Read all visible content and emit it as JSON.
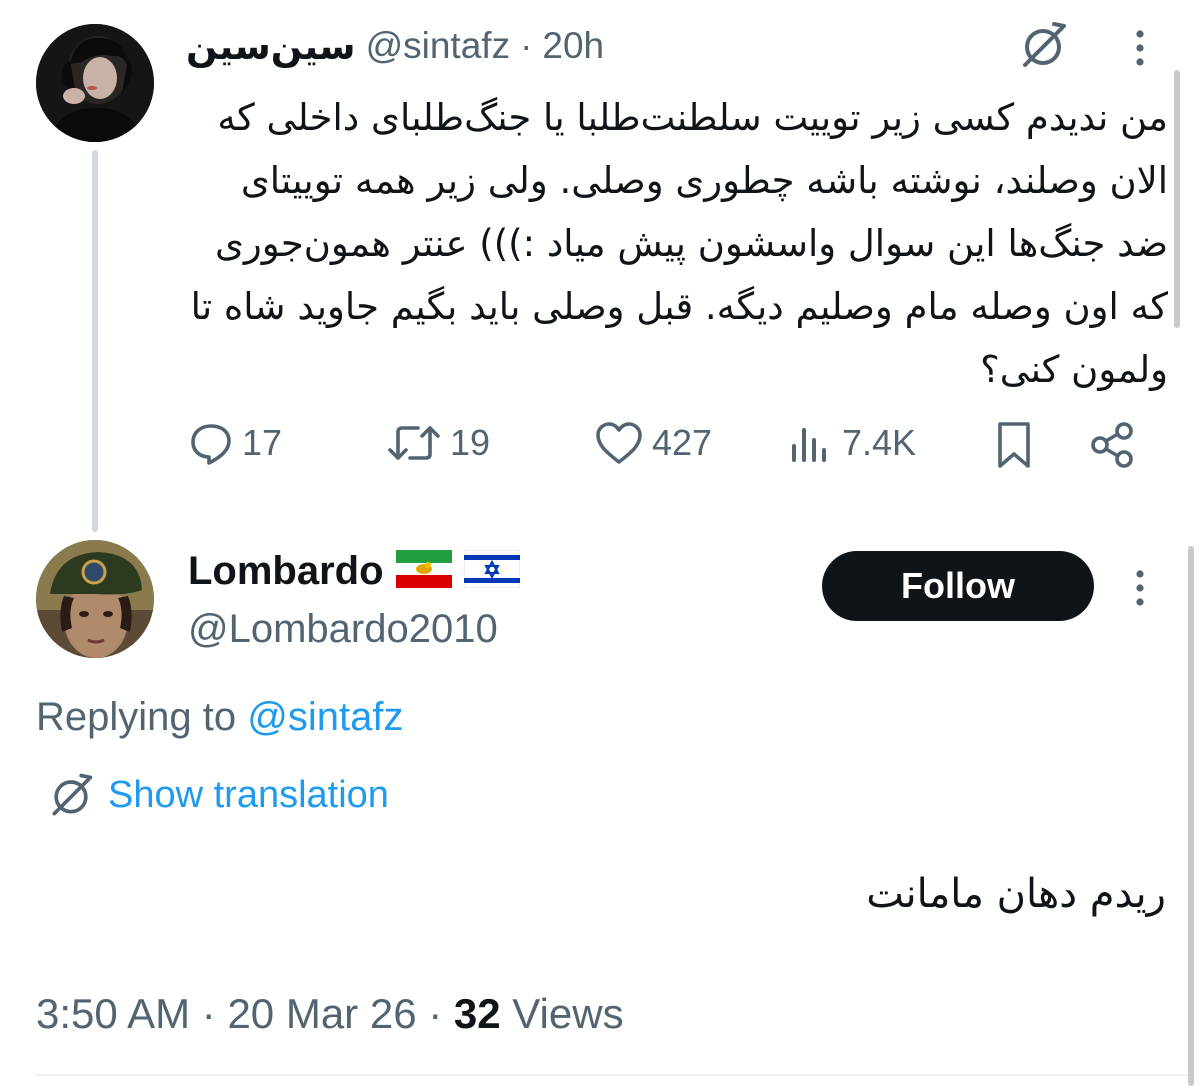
{
  "parent_tweet": {
    "display_name": "سین‌سین",
    "handle": "@sintafz",
    "separator": "·",
    "time": "20h",
    "text": "من ندیدم کسی زیر توییت سلطنت‌طلبا یا جنگ‌طلبای داخلی که الان وصلند، نوشته باشه چطوری وصلی. ولی زیر همه توییتای ضد جنگ‌ها این سوال واسشون پیش میاد :))) عنتر همون‌جوری که اون وصله مام وصلیم دیگه. قبل وصلی باید بگیم جاوید شاه تا ولمون کنی؟",
    "actions": {
      "replies": "17",
      "reposts": "19",
      "likes": "427",
      "views": "7.4K"
    },
    "icons": [
      "translate-icon",
      "more-icon",
      "reply-icon",
      "repost-icon",
      "like-icon",
      "views-icon",
      "bookmark-icon",
      "share-icon"
    ]
  },
  "reply_tweet": {
    "display_name": "Lombardo",
    "flags": [
      "🇮🇷",
      "🇮🇱"
    ],
    "handle": "@Lombardo2010",
    "follow_label": "Follow",
    "replying_to_label": "Replying to",
    "replying_to_handle": "@sintafz",
    "show_translation_label": "Show translation",
    "text": "ریدم دهان مامانت",
    "meta": {
      "time": "3:50 AM",
      "sep1": "·",
      "date": "20 Mar 26",
      "sep2": "·",
      "views_count": "32",
      "views_label": "Views"
    }
  },
  "colors": {
    "text": "#0f1419",
    "muted": "#536471",
    "link": "#1d9bf0",
    "thread_line": "#cfd9de",
    "button_bg": "#0f1419"
  }
}
